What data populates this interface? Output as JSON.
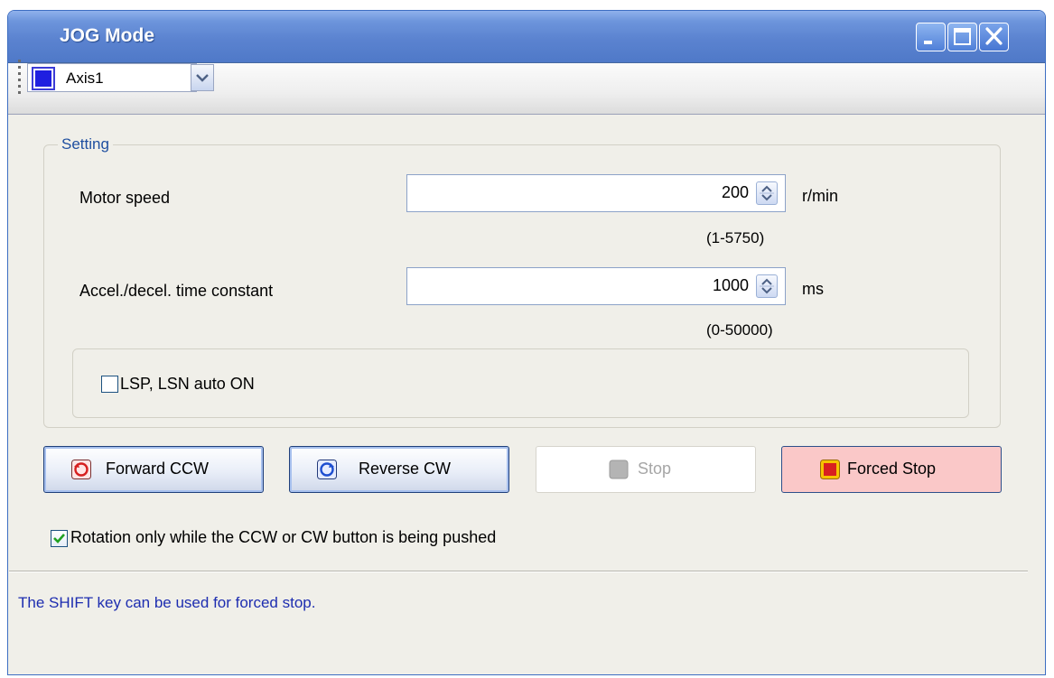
{
  "window": {
    "title": "JOG Mode",
    "controls": [
      "minimize-icon",
      "maximize-icon",
      "close-icon"
    ]
  },
  "toolbar": {
    "axis_selected": "Axis1",
    "axis_color": "#1f1fe0"
  },
  "setting": {
    "group_label": "Setting",
    "motor_speed": {
      "label": "Motor speed",
      "value": "200",
      "unit": "r/min",
      "range": "(1-5750)"
    },
    "accel": {
      "label": "Accel./decel. time constant",
      "value": "1000",
      "unit": "ms",
      "range": "(0-50000)"
    },
    "lsp_lsn": {
      "label": "LSP, LSN auto ON",
      "checked": false
    }
  },
  "buttons": {
    "forward": "Forward CCW",
    "reverse": "Reverse CW",
    "stop": "Stop",
    "forced_stop": "Forced Stop"
  },
  "rotation_option": {
    "label": "Rotation only while the CCW or CW button is being pushed",
    "checked": true
  },
  "hint": "The SHIFT key can be used for forced stop.",
  "colors": {
    "title_bar": "#5b83d0",
    "hint_text": "#1d2db0",
    "forced_stop_bg": "#fac8c8",
    "group_label": "#1f4fa0"
  }
}
